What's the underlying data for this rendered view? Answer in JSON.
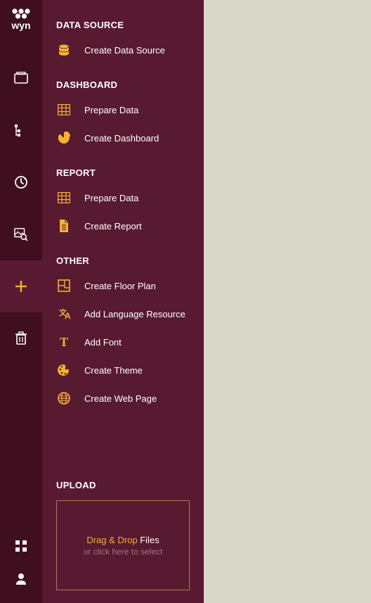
{
  "logo": "wyn",
  "rail": {
    "items": [
      {
        "name": "categories-icon"
      },
      {
        "name": "hierarchy-icon"
      },
      {
        "name": "refresh-icon"
      },
      {
        "name": "image-search-icon"
      },
      {
        "name": "add-icon",
        "active": true
      },
      {
        "name": "trash-icon"
      }
    ],
    "bottom": [
      {
        "name": "apps-icon"
      },
      {
        "name": "user-icon"
      }
    ]
  },
  "sections": [
    {
      "title": "DATA SOURCE",
      "items": [
        {
          "label": "Create Data Source",
          "icon": "database-icon"
        }
      ]
    },
    {
      "title": "DASHBOARD",
      "items": [
        {
          "label": "Prepare Data",
          "icon": "grid-icon"
        },
        {
          "label": "Create Dashboard",
          "icon": "piechart-icon"
        }
      ]
    },
    {
      "title": "REPORT",
      "items": [
        {
          "label": "Prepare Data",
          "icon": "grid-icon"
        },
        {
          "label": "Create Report",
          "icon": "document-icon"
        }
      ]
    },
    {
      "title": "OTHER",
      "items": [
        {
          "label": "Create Floor Plan",
          "icon": "floorplan-icon"
        },
        {
          "label": "Add Language Resource",
          "icon": "translate-icon"
        },
        {
          "label": "Add Font",
          "icon": "font-icon"
        },
        {
          "label": "Create Theme",
          "icon": "palette-icon"
        },
        {
          "label": "Create Web Page",
          "icon": "globe-icon"
        }
      ]
    }
  ],
  "upload": {
    "title": "UPLOAD",
    "accent": "Drag & Drop",
    "rest": " Files",
    "sub": "or click here to select"
  }
}
